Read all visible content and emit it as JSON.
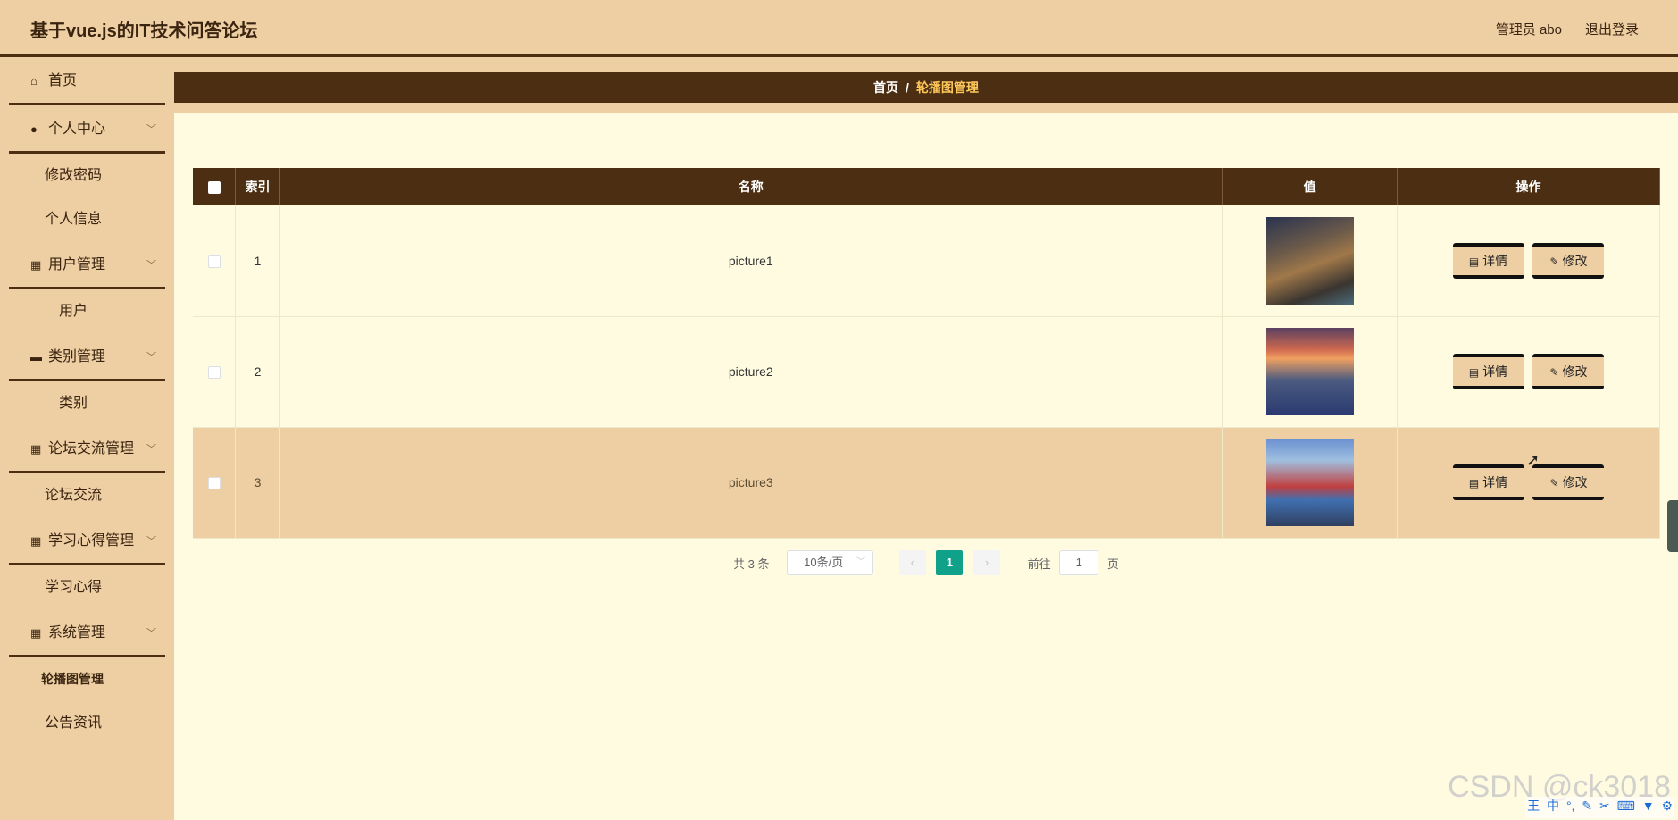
{
  "header": {
    "title": "基于vue.js的IT技术问答论坛",
    "user": "管理员 abo",
    "logout": "退出登录"
  },
  "sidebar": {
    "items": [
      {
        "label": "首页",
        "icon": "home-icon"
      },
      {
        "label": "个人中心",
        "icon": "user-icon",
        "children": [
          "修改密码",
          "个人信息"
        ]
      },
      {
        "label": "用户管理",
        "icon": "grid-icon",
        "children": [
          "用户"
        ]
      },
      {
        "label": "类别管理",
        "icon": "monitor-icon",
        "children": [
          "类别"
        ]
      },
      {
        "label": "论坛交流管理",
        "icon": "grid-icon",
        "children": [
          "论坛交流"
        ]
      },
      {
        "label": "学习心得管理",
        "icon": "grid-icon",
        "children": [
          "学习心得"
        ]
      },
      {
        "label": "系统管理",
        "icon": "grid-icon",
        "children": [
          "轮播图管理",
          "公告资讯"
        ]
      }
    ]
  },
  "breadcrumb": {
    "home": "首页",
    "separator": "/",
    "current": "轮播图管理"
  },
  "table": {
    "headers": {
      "index": "索引",
      "name": "名称",
      "value": "值",
      "action": "操作"
    },
    "rows": [
      {
        "index": "1",
        "name": "picture1"
      },
      {
        "index": "2",
        "name": "picture2"
      },
      {
        "index": "3",
        "name": "picture3"
      }
    ],
    "detail_label": "详情",
    "edit_label": "修改"
  },
  "pagination": {
    "total": "共 3 条",
    "page_size": "10条/页",
    "current_page": "1",
    "goto_label": "前往",
    "goto_value": "1",
    "page_unit": "页"
  },
  "watermark": "CSDN @ck3018",
  "ime": {
    "logo": "王",
    "mode": "中"
  },
  "colors": {
    "header_bg": "#eecfa3",
    "dark_brown": "#4c2f12",
    "page_bg": "#fffbe0",
    "breadcrumb_current": "#ffc85a",
    "pagination_active": "#10a18a"
  }
}
